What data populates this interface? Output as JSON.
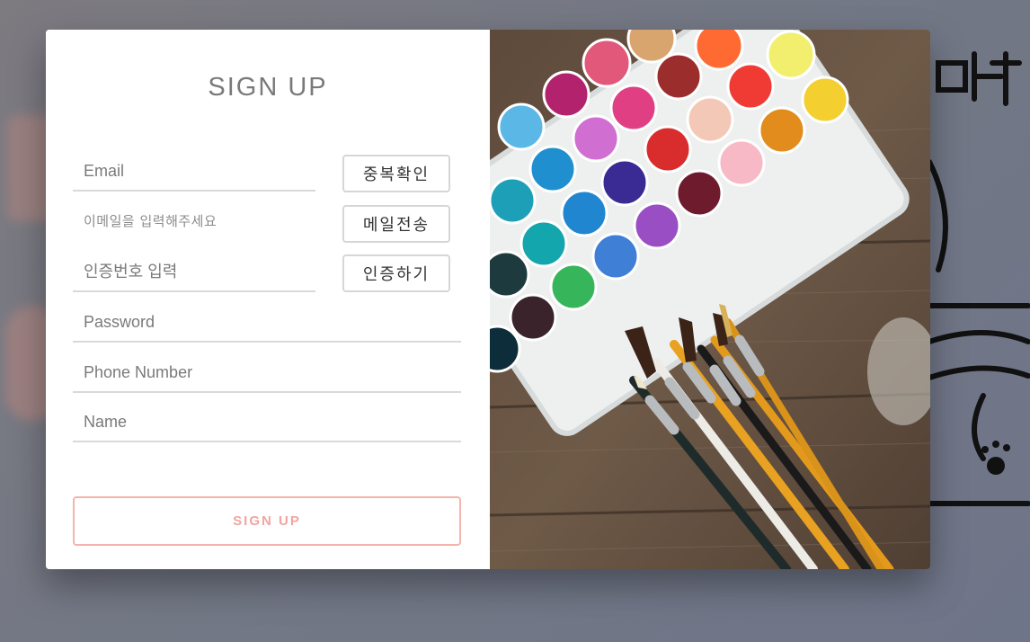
{
  "form": {
    "title": "SIGN UP",
    "email": {
      "placeholder": "Email",
      "value": ""
    },
    "email_hint": "이메일을 입력해주세요",
    "verification_code": {
      "placeholder": "인증번호 입력",
      "value": ""
    },
    "password": {
      "placeholder": "Password",
      "value": ""
    },
    "phone": {
      "placeholder": "Phone Number",
      "value": ""
    },
    "name": {
      "placeholder": "Name",
      "value": ""
    },
    "buttons": {
      "check_duplicate": "중복확인",
      "send_mail": "메일전송",
      "verify": "인증하기",
      "submit": "SIGN UP"
    }
  },
  "colors": {
    "accent": "#f4b4ad",
    "accent_text": "#f0a59f",
    "title_text": "#7a7a7a",
    "backdrop": "#737885"
  },
  "image_panel": {
    "icon": "watercolor-palette-and-brushes-photo"
  }
}
